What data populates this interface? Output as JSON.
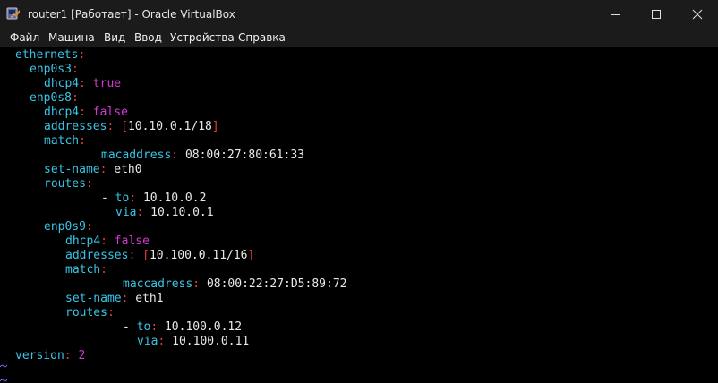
{
  "window": {
    "title": "router1 [Работает] - Oracle VirtualBox",
    "app_icon": "virtualbox-icon",
    "controls": [
      "minimize-icon",
      "maximize-icon",
      "close-icon"
    ]
  },
  "menubar": {
    "items": [
      "Файл",
      "Машина",
      "Вид",
      "Ввод",
      "Устройства",
      "Справка"
    ]
  },
  "terminal": {
    "colors": {
      "key": "#39c5e6",
      "bool": "#d43ad4",
      "bracket": "#e03c3c",
      "text": "#e8e8e8",
      "background": "#000000"
    },
    "lines": [
      {
        "key": "ethernets",
        "colon": ":"
      },
      {
        "key": "enp0s3",
        "colon": ":"
      },
      {
        "key": "dhcp4",
        "colon": ":",
        "value": "true"
      },
      {
        "key": "enp0s8",
        "colon": ":"
      },
      {
        "key": "dhcp4",
        "colon": ":",
        "value": "false"
      },
      {
        "key": "addresses",
        "colon": ":",
        "lb": "[",
        "value": "10.10.0.1/18",
        "rb": "]"
      },
      {
        "key": "match",
        "colon": ":"
      },
      {
        "key": "macaddress",
        "colon": ":",
        "value": "08:00:27:80:61:33"
      },
      {
        "key": "set-name",
        "colon": ":",
        "value": "eth0"
      },
      {
        "key": "routes",
        "colon": ":"
      },
      {
        "dash": "-",
        "key": "to",
        "colon": ":",
        "value": "10.10.0.2"
      },
      {
        "key": "via",
        "colon": ":",
        "value": "10.10.0.1"
      },
      {
        "key": "enp0s9",
        "colon": ":"
      },
      {
        "key": "dhcp4",
        "colon": ":",
        "value": "false"
      },
      {
        "key": "addresses",
        "colon": ":",
        "lb": "[",
        "value": "10.100.0.11/16",
        "rb": "]"
      },
      {
        "key": "match",
        "colon": ":"
      },
      {
        "key": "maccadress",
        "colon": ":",
        "value": "08:00:22:27:D5:89:72"
      },
      {
        "key": "set-name",
        "colon": ":",
        "value": "eth1"
      },
      {
        "key": "routes",
        "colon": ":"
      },
      {
        "dash": "-",
        "key": "to",
        "colon": ":",
        "value": "10.100.0.12"
      },
      {
        "key": "via",
        "colon": ":",
        "value": "10.100.0.11"
      },
      {
        "key": "version",
        "colon": ":",
        "value": "2"
      }
    ]
  }
}
